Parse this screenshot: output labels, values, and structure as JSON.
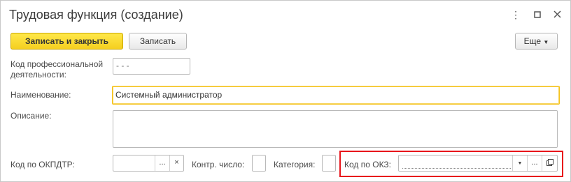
{
  "window": {
    "title": "Трудовая функция (создание)"
  },
  "icons": {
    "more": "more-vertical-icon",
    "maximize": "maximize-icon",
    "close": "close-icon",
    "choose": "ellipsis-icon",
    "clear": "clear-icon",
    "dropdown": "dropdown-icon",
    "open": "open-icon"
  },
  "toolbar": {
    "save_close_label": "Записать и закрыть",
    "save_label": "Записать",
    "more_label": "Еще"
  },
  "form": {
    "prof_code_label": "Код профессиональной деятельности:",
    "prof_code_value": "- - -",
    "name_label": "Наименование:",
    "name_value": "Системный администратор",
    "description_label": "Описание:",
    "description_value": "",
    "okpdtr_label": "Код по ОКПДТР:",
    "okpdtr_value": "",
    "control_number_label": "Контр. число:",
    "category_label": "Категория:",
    "okz_label": "Код по ОКЗ:",
    "okz_value": ""
  },
  "colors": {
    "accent": "#f5cf1f",
    "highlight": "#e8141b"
  }
}
